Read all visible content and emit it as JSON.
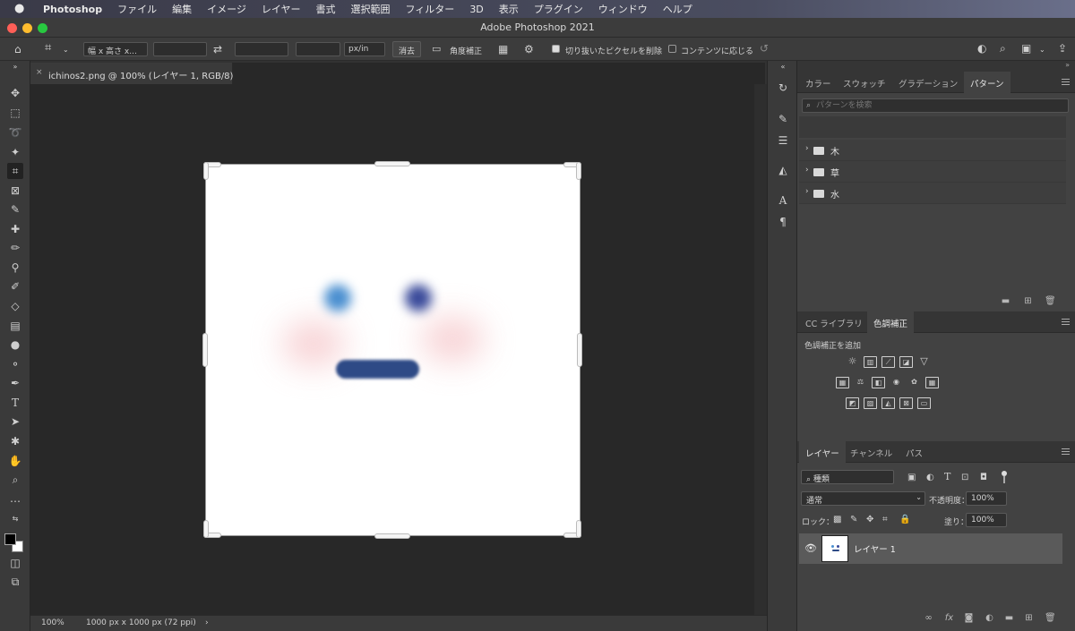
{
  "menubar": {
    "app_name": "Photoshop",
    "items": [
      "ファイル",
      "編集",
      "イメージ",
      "レイヤー",
      "書式",
      "選択範囲",
      "フィルター",
      "3D",
      "表示",
      "プラグイン",
      "ウィンドウ",
      "ヘルプ"
    ]
  },
  "window": {
    "title": "Adobe Photoshop 2021"
  },
  "options_bar": {
    "ratio_preset": "幅 x 高さ x...",
    "unit": "px/in",
    "clear_label": "消去",
    "straighten_label": "角度補正",
    "delete_cropped_label": "切り抜いたピクセルを削除",
    "delete_cropped_checked": true,
    "content_aware_label": "コンテンツに応じる",
    "content_aware_checked": false
  },
  "document": {
    "tab_title": "ichinos2.png @ 100% (レイヤー 1, RGB/8)",
    "close_glyph": "×",
    "zoom": "100%",
    "info": "1000 px x 1000 px (72 ppi)",
    "info_arrow": "›"
  },
  "colors": {
    "eye_left": "#4a8fd0",
    "eye_right": "#3a4a9a",
    "mouth": "#2e4a86",
    "cheek": "#f6c9cc"
  },
  "patterns_panel": {
    "tabs": [
      "カラー",
      "スウォッチ",
      "グラデーション",
      "パターン"
    ],
    "active_tab": "パターン",
    "search_placeholder": "パターンを検索",
    "groups": [
      "木",
      "草",
      "水"
    ]
  },
  "adjust_panel": {
    "tabs": [
      "CC ライブラリ",
      "色調補正"
    ],
    "active_tab": "色調補正",
    "heading": "色調補正を追加"
  },
  "layers_panel": {
    "tabs": [
      "レイヤー",
      "チャンネル",
      "パス"
    ],
    "active_tab": "レイヤー",
    "filter_label": "種類",
    "blend_mode": "通常",
    "opacity_label": "不透明度：",
    "opacity_value": "100%",
    "lock_label": "ロック：",
    "fill_label": "塗り：",
    "fill_value": "100%",
    "layers": [
      {
        "name": "レイヤー 1",
        "visible": true
      }
    ]
  }
}
